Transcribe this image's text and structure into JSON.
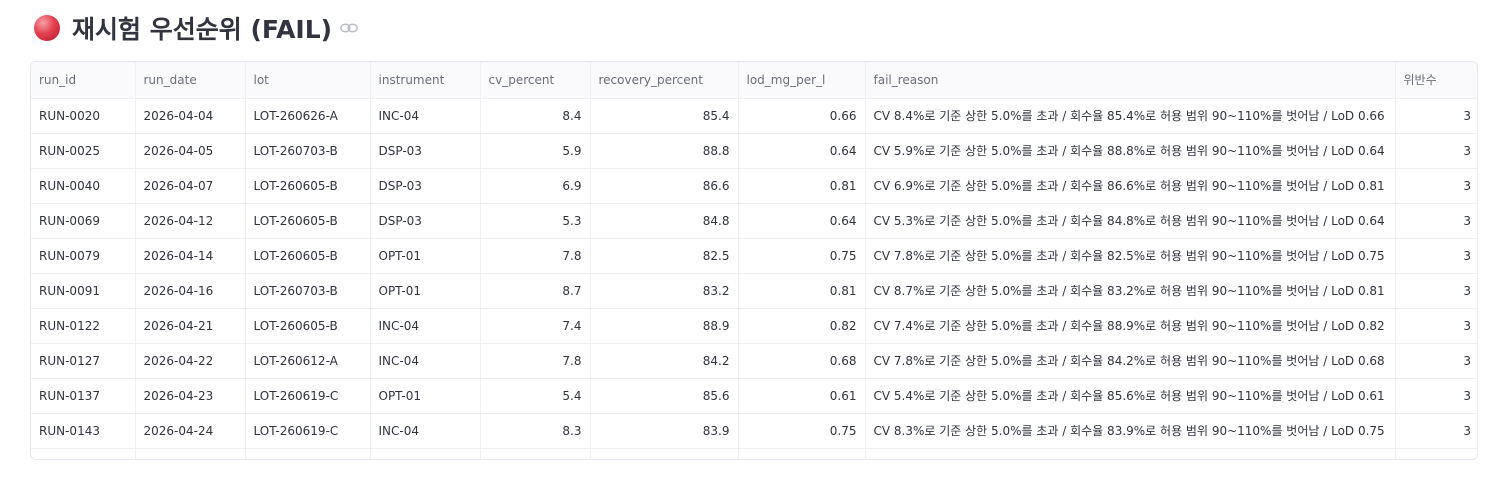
{
  "header": {
    "title_main": "재시험 우선순위",
    "title_paren": "(FAIL)",
    "status_color": "#e3404e",
    "link_icon": "link-icon"
  },
  "table": {
    "columns": [
      "run_id",
      "run_date",
      "lot",
      "instrument",
      "cv_percent",
      "recovery_percent",
      "lod_mg_per_l",
      "fail_reason",
      "위반수"
    ],
    "rows": [
      [
        "RUN-0020",
        "2026-04-04",
        "LOT-260626-A",
        "INC-04",
        "8.4",
        "85.4",
        "0.66",
        "CV 8.4%로 기준 상한 5.0%를 초과 / 회수율 85.4%로 허용 범위 90~110%를 벗어남 / LoD 0.66",
        "3"
      ],
      [
        "RUN-0025",
        "2026-04-05",
        "LOT-260703-B",
        "DSP-03",
        "5.9",
        "88.8",
        "0.64",
        "CV 5.9%로 기준 상한 5.0%를 초과 / 회수율 88.8%로 허용 범위 90~110%를 벗어남 / LoD 0.64",
        "3"
      ],
      [
        "RUN-0040",
        "2026-04-07",
        "LOT-260605-B",
        "DSP-03",
        "6.9",
        "86.6",
        "0.81",
        "CV 6.9%로 기준 상한 5.0%를 초과 / 회수율 86.6%로 허용 범위 90~110%를 벗어남 / LoD 0.81",
        "3"
      ],
      [
        "RUN-0069",
        "2026-04-12",
        "LOT-260605-B",
        "DSP-03",
        "5.3",
        "84.8",
        "0.64",
        "CV 5.3%로 기준 상한 5.0%를 초과 / 회수율 84.8%로 허용 범위 90~110%를 벗어남 / LoD 0.64",
        "3"
      ],
      [
        "RUN-0079",
        "2026-04-14",
        "LOT-260605-B",
        "OPT-01",
        "7.8",
        "82.5",
        "0.75",
        "CV 7.8%로 기준 상한 5.0%를 초과 / 회수율 82.5%로 허용 범위 90~110%를 벗어남 / LoD 0.75",
        "3"
      ],
      [
        "RUN-0091",
        "2026-04-16",
        "LOT-260703-B",
        "OPT-01",
        "8.7",
        "83.2",
        "0.81",
        "CV 8.7%로 기준 상한 5.0%를 초과 / 회수율 83.2%로 허용 범위 90~110%를 벗어남 / LoD 0.81",
        "3"
      ],
      [
        "RUN-0122",
        "2026-04-21",
        "LOT-260605-B",
        "INC-04",
        "7.4",
        "88.9",
        "0.82",
        "CV 7.4%로 기준 상한 5.0%를 초과 / 회수율 88.9%로 허용 범위 90~110%를 벗어남 / LoD 0.82",
        "3"
      ],
      [
        "RUN-0127",
        "2026-04-22",
        "LOT-260612-A",
        "INC-04",
        "7.8",
        "84.2",
        "0.68",
        "CV 7.8%로 기준 상한 5.0%를 초과 / 회수율 84.2%로 허용 범위 90~110%를 벗어남 / LoD 0.68",
        "3"
      ],
      [
        "RUN-0137",
        "2026-04-23",
        "LOT-260619-C",
        "OPT-01",
        "5.4",
        "85.6",
        "0.61",
        "CV 5.4%로 기준 상한 5.0%를 초과 / 회수율 85.6%로 허용 범위 90~110%를 벗어남 / LoD 0.61",
        "3"
      ],
      [
        "RUN-0143",
        "2026-04-24",
        "LOT-260619-C",
        "INC-04",
        "8.3",
        "83.9",
        "0.75",
        "CV 8.3%로 기준 상한 5.0%를 초과 / 회수율 83.9%로 허용 범위 90~110%를 벗어남 / LoD 0.75",
        "3"
      ]
    ]
  }
}
